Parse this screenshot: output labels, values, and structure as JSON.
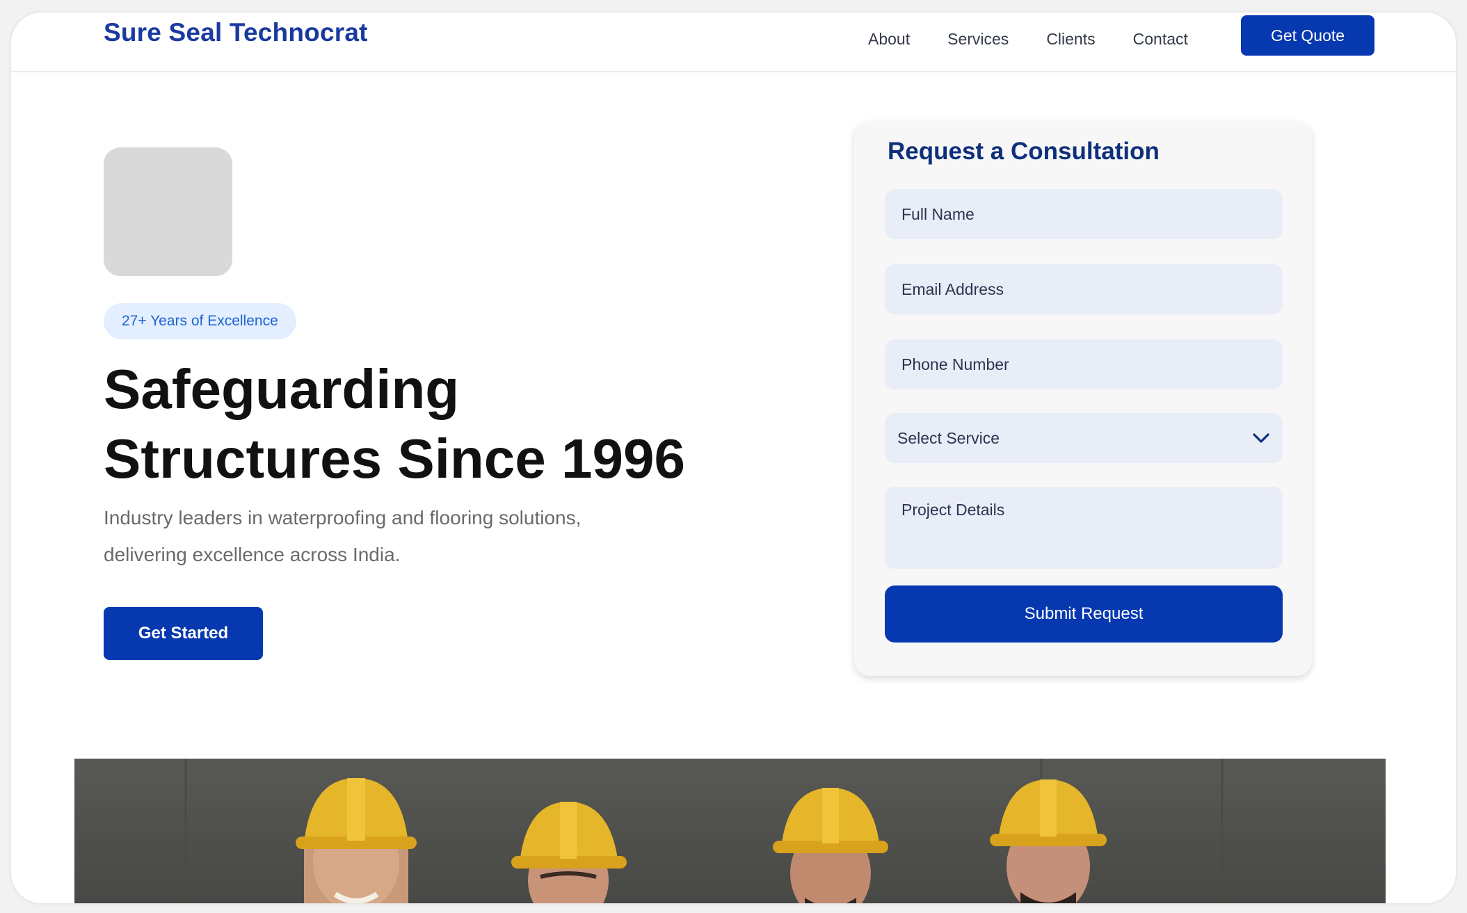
{
  "header": {
    "brand": "Sure Seal Technocrat",
    "nav": [
      "About",
      "Services",
      "Clients",
      "Contact"
    ],
    "cta": "Get Quote"
  },
  "hero": {
    "badge": "27+ Years of Excellence",
    "title_line1": "Safeguarding",
    "title_line2": "Structures Since 1996",
    "subtitle_line1": "Industry leaders in waterproofing and flooring solutions,",
    "subtitle_line2": "delivering excellence across India.",
    "cta": "Get Started"
  },
  "form": {
    "title": "Request a Consultation",
    "full_name_placeholder": "Full Name",
    "email_placeholder": "Email Address",
    "phone_placeholder": "Phone Number",
    "service_selected": "Select Service",
    "details_placeholder": "Project Details",
    "submit": "Submit Request"
  },
  "colors": {
    "primary": "#0638b0",
    "brand_text": "#1a3aa0",
    "badge_bg": "#e3efff",
    "badge_text": "#1e63d6",
    "field_bg": "#e8edf7",
    "helmet": "#e6b62a"
  },
  "icons": {
    "select_chevron": "chevron-down-icon"
  }
}
